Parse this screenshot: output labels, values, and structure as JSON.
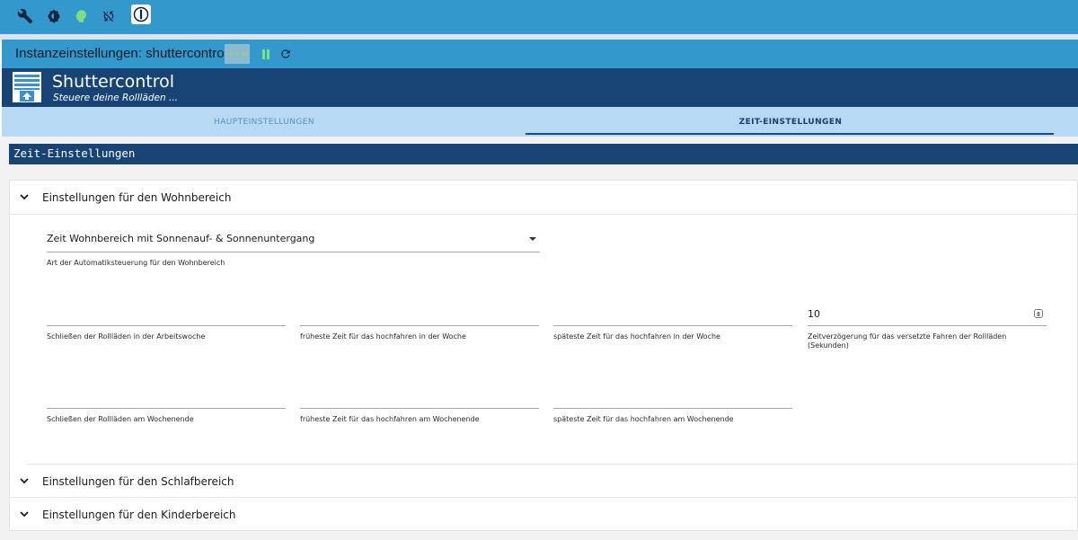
{
  "toolbar": {
    "icons": [
      "wrench-icon",
      "settings-brightness-icon",
      "head-icon",
      "sync-disabled-icon",
      "info-icon"
    ]
  },
  "instance": {
    "title": "Instanzeinstellungen: shuttercontrol.0",
    "version": "v1.4.16"
  },
  "adapter": {
    "name": "Shuttercontrol",
    "subtitle": "Steuere deine Rollläden ..."
  },
  "tabs": [
    {
      "label": "HAUPTEINSTELLUNGEN",
      "active": false
    },
    {
      "label": "ZEIT-EINSTELLUNGEN",
      "active": true
    }
  ],
  "section": {
    "title": "Zeit-Einstellungen"
  },
  "wohnbereich": {
    "header": "Einstellungen für den Wohnbereich",
    "mode_select": {
      "value": "Zeit Wohnbereich mit Sonnenauf- & Sonnenuntergang",
      "help": "Art der Automatiksteuerung für den Wohnbereich"
    },
    "fields_week": [
      {
        "value": "",
        "help": "Schließen der Rollläden in der Arbeitswoche"
      },
      {
        "value": "",
        "help": "früheste Zeit für das hochfahren in der Woche"
      },
      {
        "value": "",
        "help": "späteste Zeit für das hochfahren in der Woche"
      },
      {
        "value": "10",
        "help": "Zeitverzögerung für das versetzte Fahren der Rollläden (Sekunden)"
      }
    ],
    "fields_weekend": [
      {
        "value": "",
        "help": "Schließen der Rollläden am Wochenende"
      },
      {
        "value": "",
        "help": "früheste Zeit für das hochfahren am Wochenende"
      },
      {
        "value": "",
        "help": "späteste Zeit für das hochfahren am Wochenende"
      }
    ]
  },
  "schlafbereich": {
    "header": "Einstellungen für den Schlafbereich"
  },
  "kinderbereich": {
    "header": "Einstellungen für den Kinderbereich"
  }
}
